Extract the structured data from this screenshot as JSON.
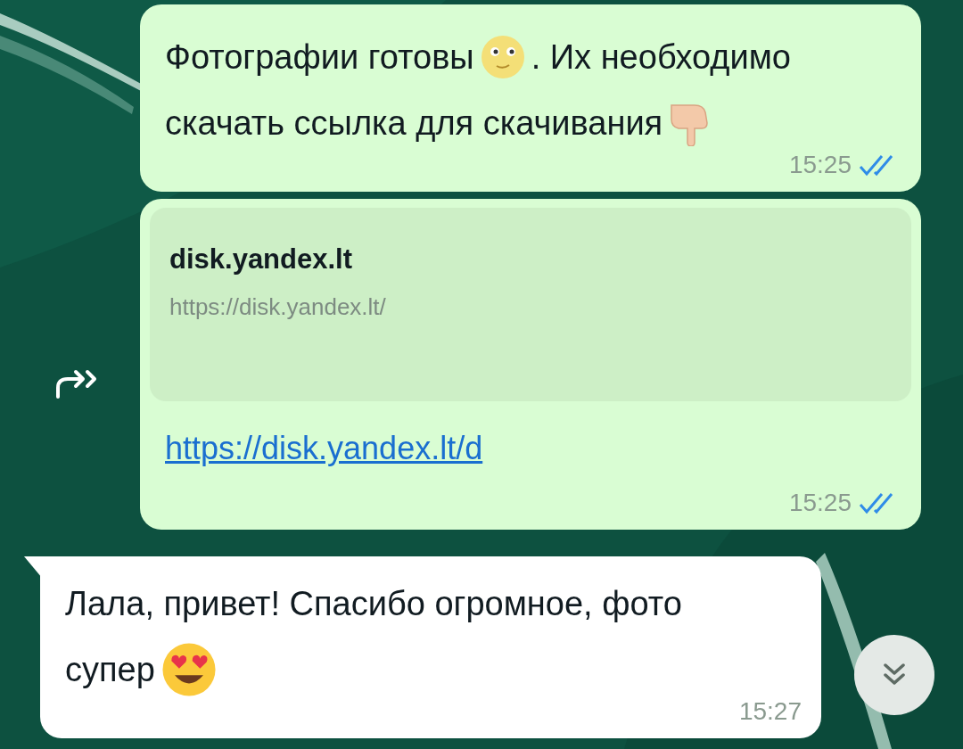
{
  "messages": [
    {
      "kind": "text",
      "outgoing": true,
      "lines": [
        [
          {
            "kind": "text",
            "text": "Фотографии готовы"
          },
          {
            "kind": "moon"
          },
          {
            "kind": "text",
            "text": ". Их необходимо"
          }
        ],
        [
          {
            "kind": "text",
            "text": "скачать ссылка для скачивания"
          },
          {
            "kind": "hand"
          }
        ]
      ],
      "time": "15:25",
      "read": true
    },
    {
      "kind": "link",
      "outgoing": true,
      "share_button": true,
      "preview": {
        "title": "disk.yandex.lt",
        "url": "https://disk.yandex.lt/"
      },
      "link": "https://disk.yandex.lt/d",
      "time": "15:25",
      "read": true
    },
    {
      "kind": "text",
      "outgoing": false,
      "lines": [
        [
          {
            "kind": "text",
            "text": "Лала, привет! Спасибо огромное, фото"
          }
        ],
        [
          {
            "kind": "text",
            "text": "супер"
          },
          {
            "kind": "heart_eyes"
          }
        ]
      ],
      "time": "15:27"
    }
  ]
}
